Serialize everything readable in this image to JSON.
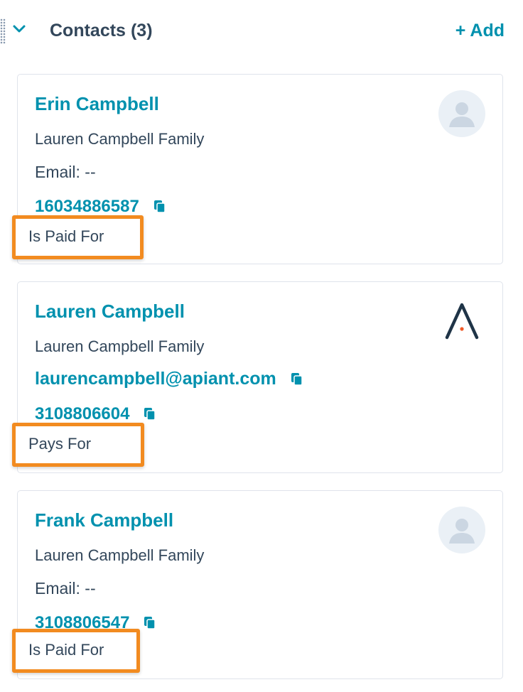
{
  "section": {
    "title": "Contacts",
    "count": "(3)",
    "add_label": "+ Add"
  },
  "contacts": [
    {
      "name": "Erin Campbell",
      "company": "Lauren Campbell Family",
      "email": "Email: --",
      "phone": "16034886587",
      "label": "Is Paid For",
      "avatar": "default-person-avatar-icon"
    },
    {
      "name": "Lauren Campbell",
      "company": "Lauren Campbell Family",
      "email": "laurencampbell@apiant.com",
      "phone": "3108806604",
      "label": "Pays For",
      "avatar": "company-logo-icon"
    },
    {
      "name": "Frank Campbell",
      "company": "Lauren Campbell Family",
      "email": "Email: --",
      "phone": "3108806547",
      "label": "Is Paid For",
      "avatar": "default-person-avatar-icon"
    }
  ],
  "colors": {
    "link": "#0091ae",
    "text": "#33475b",
    "highlight": "#f28b20",
    "border": "#dfe3eb",
    "avatar_bg": "#eaf0f6"
  }
}
